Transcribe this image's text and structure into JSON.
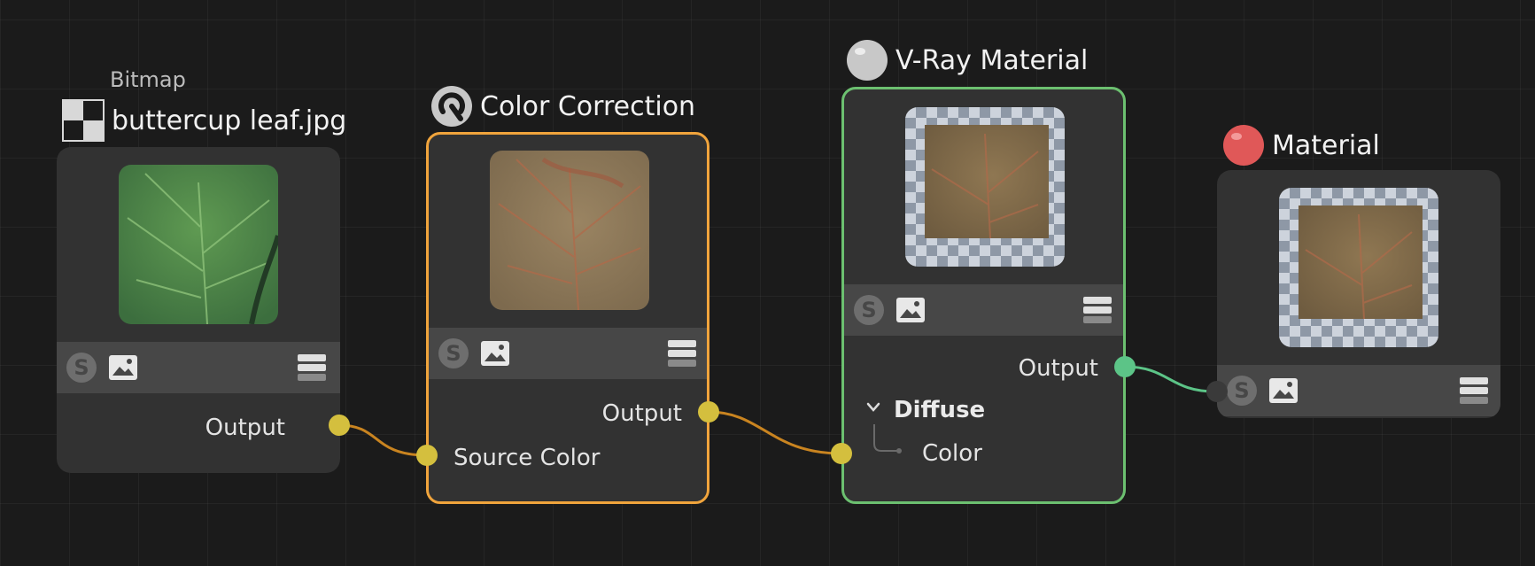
{
  "nodes": {
    "bitmap": {
      "subtitle": "Bitmap",
      "title": "buttercup leaf.jpg",
      "output_label": "Output"
    },
    "color_correction": {
      "title": "Color Correction",
      "output_label": "Output",
      "input_label": "Source Color"
    },
    "vray_material": {
      "title": "V-Ray Material",
      "output_label": "Output",
      "section_label": "Diffuse",
      "input_label": "Color"
    },
    "material": {
      "title": "Material"
    }
  },
  "colors": {
    "background": "#1b1b1b",
    "node_body": "#323232",
    "toolbar": "#474747",
    "port_yellow": "#d4bf3e",
    "port_green": "#5cc487",
    "wire_orange": "#c98420",
    "wire_green": "#5cc487",
    "selected_orange": "#f0a43c",
    "selected_green": "#6cc070",
    "material_ball_red": "#e05858",
    "material_ball_gray": "#c8c8c8"
  }
}
